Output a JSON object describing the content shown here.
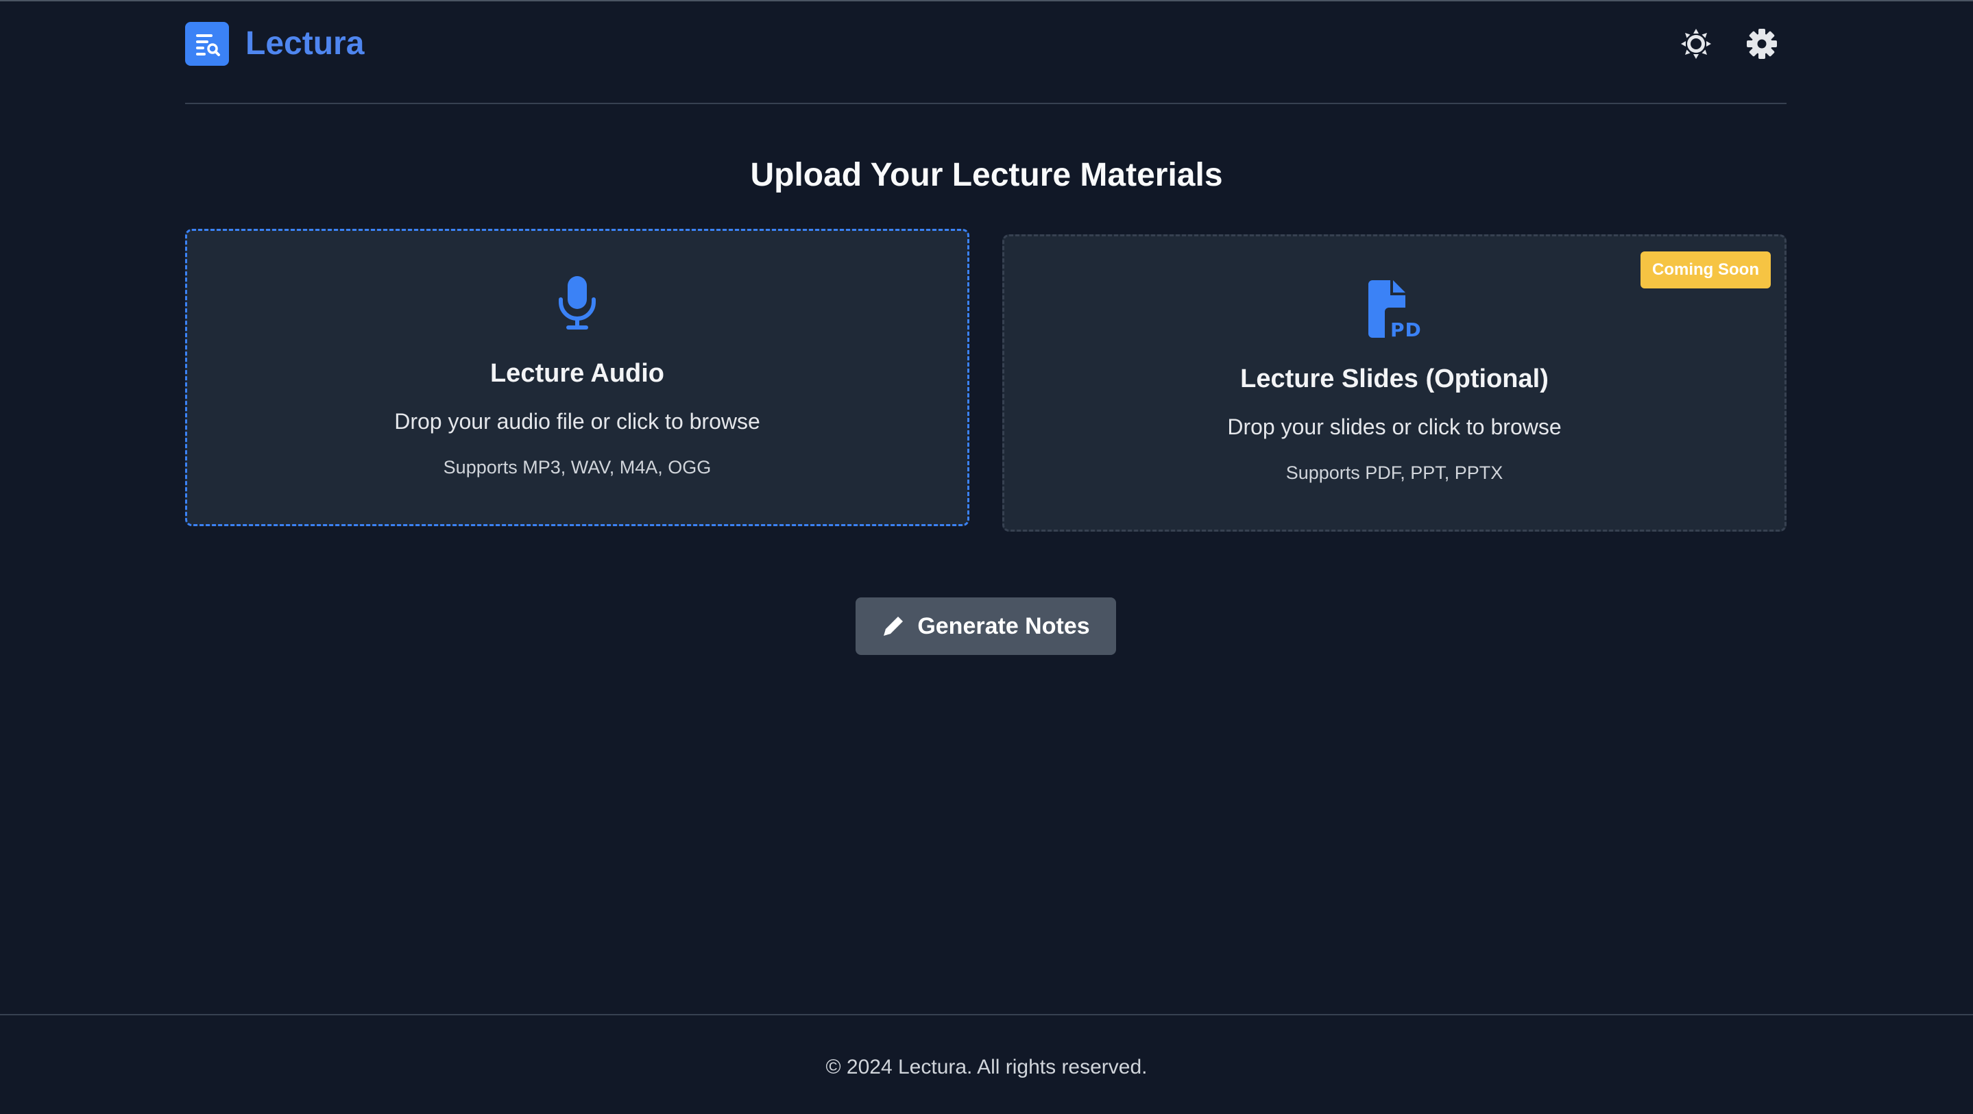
{
  "header": {
    "app_title": "Lectura",
    "logo_icon": "notes-search-icon",
    "theme_icon": "sun-icon",
    "settings_icon": "gear-icon"
  },
  "main": {
    "title": "Upload Your Lecture Materials",
    "audio_card": {
      "icon": "microphone-icon",
      "heading": "Lecture Audio",
      "description": "Drop your audio file or click to browse",
      "supports": "Supports MP3, WAV, M4A, OGG"
    },
    "slides_card": {
      "icon": "pdf-file-icon",
      "badge": "Coming Soon",
      "heading": "Lecture Slides (Optional)",
      "description": "Drop your slides or click to browse",
      "supports": "Supports PDF, PPT, PPTX"
    },
    "generate_button": {
      "icon": "pencil-icon",
      "label": "Generate Notes"
    }
  },
  "footer": {
    "copyright": "© 2024 Lectura. All rights reserved."
  },
  "colors": {
    "background": "#111827",
    "card": "#1f2937",
    "accent": "#3b82f6",
    "badge": "#f6c443",
    "button": "#4b5563"
  }
}
